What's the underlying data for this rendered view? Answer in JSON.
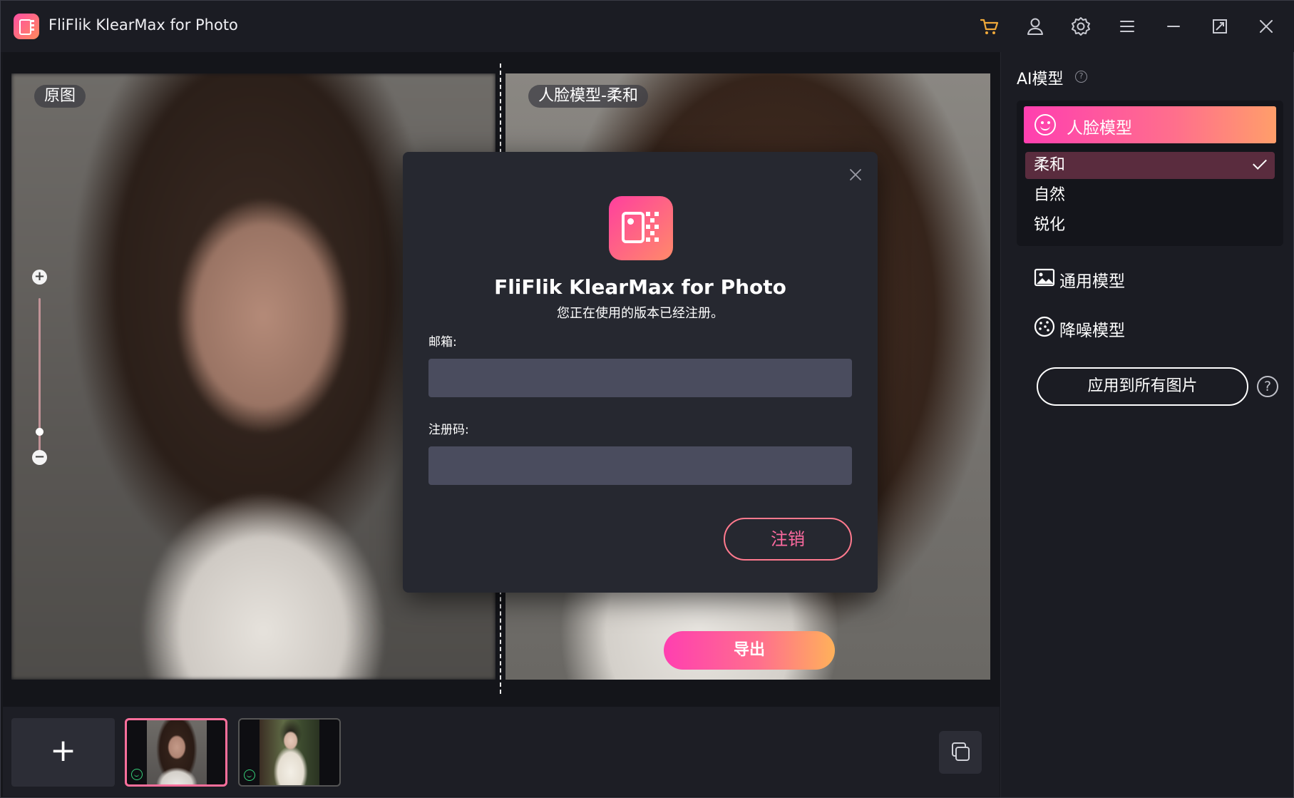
{
  "app": {
    "title": "FliFlik KlearMax for Photo",
    "accent_color": "#ff4fa3"
  },
  "titlebar": {
    "icons": [
      "cart-icon",
      "user-icon",
      "settings-icon",
      "menu-icon",
      "minimize-icon",
      "maximize-icon",
      "close-icon"
    ]
  },
  "workspace": {
    "left_tag": "原图",
    "right_tag": "人脸模型-柔和",
    "export_label": "导出"
  },
  "sidebar": {
    "title": "AI模型",
    "active_model": "人脸模型",
    "sub_options": [
      {
        "label": "柔和",
        "selected": true
      },
      {
        "label": "自然",
        "selected": false
      },
      {
        "label": "锐化",
        "selected": false
      }
    ],
    "other_models": [
      {
        "label": "通用模型",
        "icon": "image-icon"
      },
      {
        "label": "降噪模型",
        "icon": "denoise-icon"
      }
    ],
    "apply_label": "应用到所有图片",
    "help_glyph": "?"
  },
  "bottombar": {
    "add_glyph": "+",
    "thumbnails": [
      {
        "name": "thumbnail-portrait-1",
        "selected": true,
        "processed": true
      },
      {
        "name": "thumbnail-portrait-2",
        "selected": false,
        "processed": true
      }
    ]
  },
  "modal": {
    "title": "FliFlik KlearMax for Photo",
    "subtitle": "您正在使用的版本已经注册。",
    "email_label": "邮箱:",
    "email_value": "",
    "code_label": "注册码:",
    "code_value": "",
    "logout_label": "注销"
  }
}
